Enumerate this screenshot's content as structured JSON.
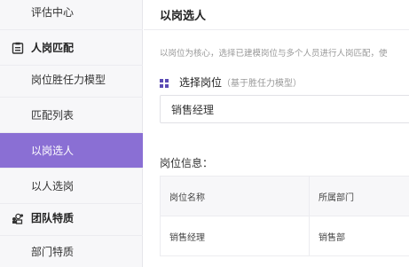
{
  "sidebar": {
    "top_item": "评估中心",
    "group_match": "人岗匹配",
    "items_match": [
      "岗位胜任力模型",
      "匹配列表",
      "以岗选人",
      "以人选岗"
    ],
    "group_team": "团队特质",
    "items_team": [
      "部门特质"
    ],
    "active_color": "#8a6fd4"
  },
  "main": {
    "title": "以岗选人",
    "description": "以岗位为核心，选择已建模岗位与多个人员进行人岗匹配，使",
    "select_label": "选择岗位",
    "select_hint": "（基于胜任力模型）",
    "selected_position": "销售经理",
    "info_title": "岗位信息：",
    "table": {
      "headers": [
        "岗位名称",
        "所属部门"
      ],
      "rows": [
        [
          "销售经理",
          "销售部"
        ]
      ]
    }
  }
}
